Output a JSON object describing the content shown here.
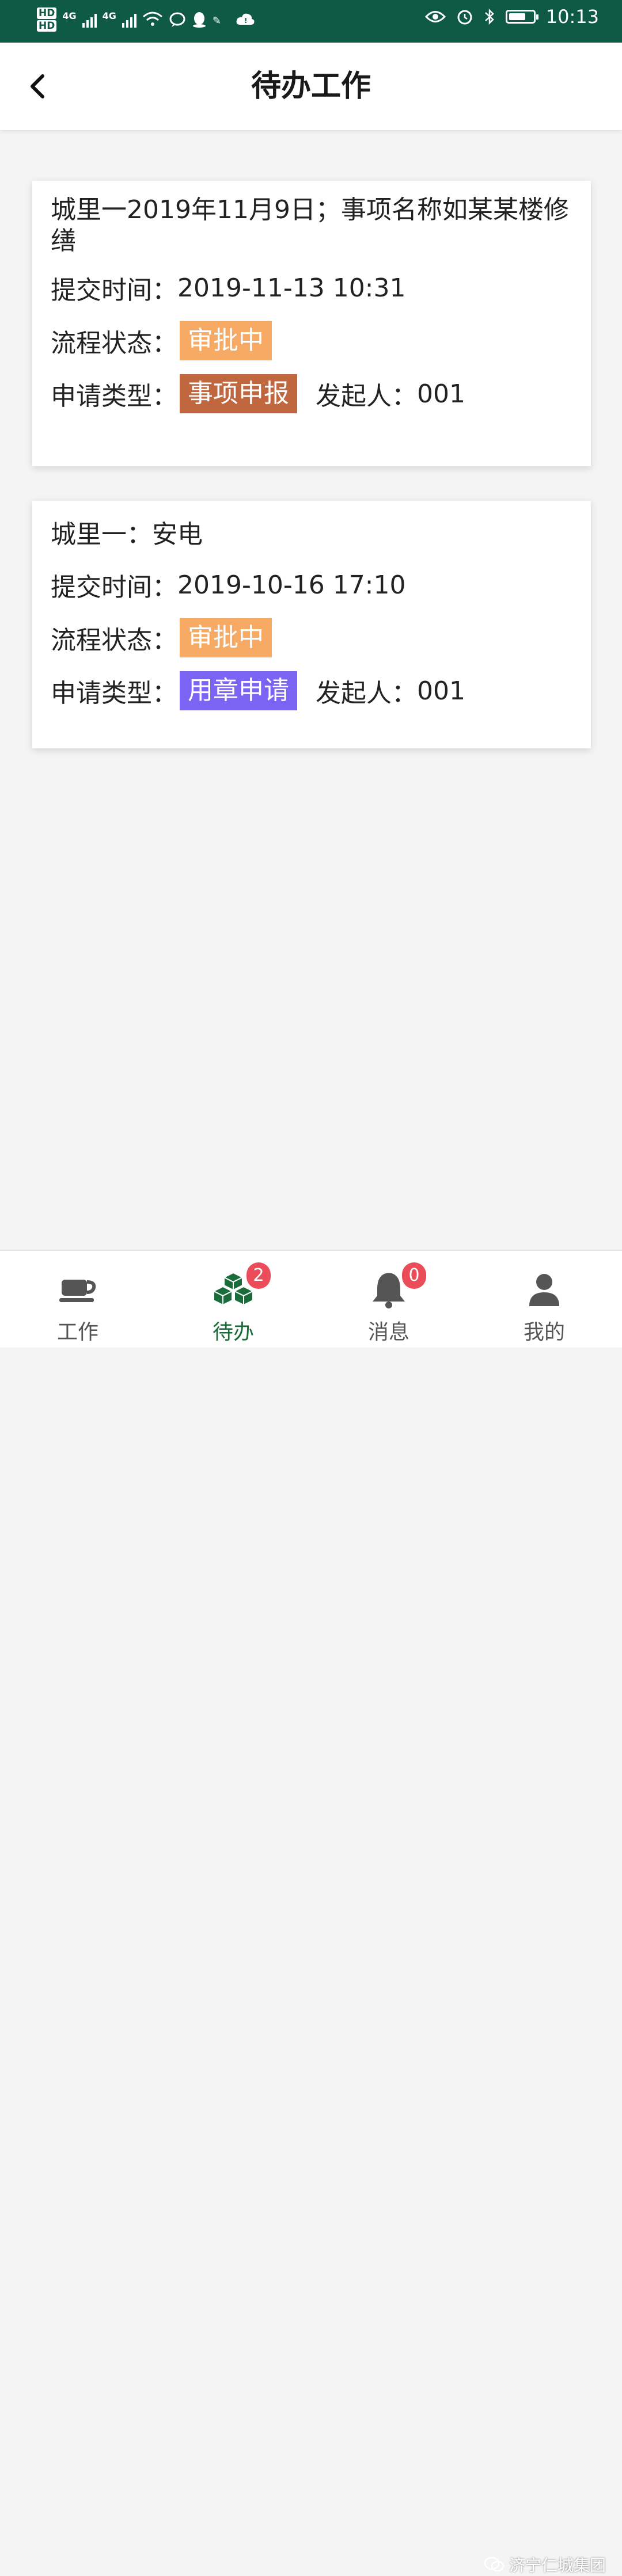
{
  "status_bar": {
    "hd1": "HD",
    "hd2": "HD",
    "net1": "4G",
    "net2": "4G",
    "time": "10:13",
    "battery_level": 0.7,
    "icons": [
      "wifi-icon",
      "message-icon",
      "qq-icon",
      "app-icon",
      "cloud-icon",
      "eye-icon",
      "alarm-icon",
      "bluetooth-icon",
      "battery-icon"
    ]
  },
  "header": {
    "title": "待办工作",
    "back_icon": "chevron-left-icon"
  },
  "tasks": [
    {
      "title": "城里一2019年11月9日；事项名称如某某楼修缮",
      "submit_label": "提交时间：",
      "submit_time": "2019-11-13 10:31",
      "status_label": "流程状态：",
      "status": "审批中",
      "type_label": "申请类型：",
      "type": "事项申报",
      "initiator_label": "发起人：",
      "initiator": "001",
      "type_color": "#c1673f"
    },
    {
      "title": "城里一：安电",
      "submit_label": "提交时间：",
      "submit_time": "2019-10-16 17:10",
      "status_label": "流程状态：",
      "status": "审批中",
      "type_label": "申请类型：",
      "type": "用章申请",
      "initiator_label": "发起人：",
      "initiator": "001",
      "type_color": "#7b63f4"
    }
  ],
  "colors": {
    "status_bar": "#0f5a45",
    "status_tag": "#f6aa64",
    "badge": "#ea4c59",
    "active_nav": "#1a6d3a"
  },
  "bottom_nav": {
    "items": [
      {
        "label": "工作",
        "icon": "coffee-cup-icon"
      },
      {
        "label": "待办",
        "icon": "boxes-icon",
        "badge": "2"
      },
      {
        "label": "消息",
        "icon": "bell-icon",
        "badge": "0"
      },
      {
        "label": "我的",
        "icon": "user-icon"
      }
    ],
    "active": 1
  },
  "watermark": "济宁仁城集团"
}
